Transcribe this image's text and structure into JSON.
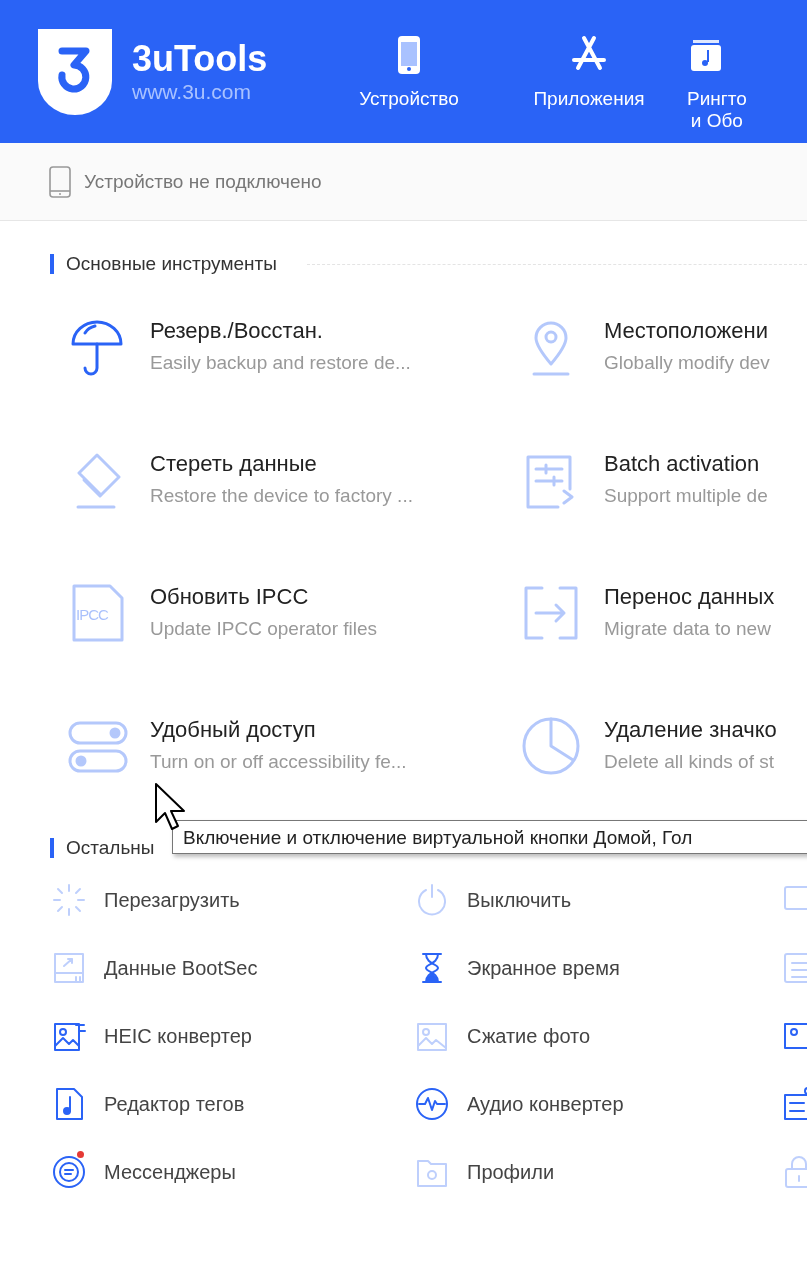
{
  "header": {
    "app_name": "3uTools",
    "site": "www.3u.com",
    "nav": [
      {
        "label": "Устройство"
      },
      {
        "label": "Приложения"
      },
      {
        "label": "Рингто",
        "label_line2": "и Обо"
      }
    ]
  },
  "device_bar": {
    "status": "Устройство не подключено"
  },
  "main_tools": {
    "title": "Основные инструменты",
    "items": [
      {
        "title": "Резерв./Восстан.",
        "description": "Easily backup and restore de...",
        "disabled": false
      },
      {
        "title": "Местоположени",
        "description": "Globally modify dev",
        "disabled": true
      },
      {
        "title": "Стереть данные",
        "description": "Restore the device to factory ...",
        "disabled": true
      },
      {
        "title": "Batch activation",
        "description": "Support multiple de",
        "disabled": true
      },
      {
        "title": "Обновить IPCC",
        "description": "Update IPCC operator files",
        "disabled": true,
        "icon_text": "IPCC"
      },
      {
        "title": "Перенос данных",
        "description": "Migrate data to new",
        "disabled": true
      },
      {
        "title": "Удобный доступ",
        "description": "Turn on or off accessibility fe...",
        "disabled": true
      },
      {
        "title": "Удаление значко",
        "description": "Delete all kinds of st",
        "disabled": true
      }
    ]
  },
  "tooltip": {
    "text": "Включение и отключение виртуальной кнопки Домой, Гол"
  },
  "other_tools": {
    "title": "Остальны",
    "items": [
      {
        "label": "Перезагрузить",
        "disabled": true,
        "new_dot": false
      },
      {
        "label": "Выключить",
        "disabled": true,
        "new_dot": false
      },
      {
        "disabled": true,
        "new_dot": false
      },
      {
        "label": "Данные BootSec",
        "disabled": true,
        "new_dot": false
      },
      {
        "label": "Экранное время",
        "disabled": false,
        "new_dot": false
      },
      {
        "disabled": true,
        "new_dot": false
      },
      {
        "label": "HEIC конвертер",
        "disabled": false,
        "new_dot": false
      },
      {
        "label": "Сжатие фото",
        "disabled": true,
        "new_dot": false
      },
      {
        "disabled": false,
        "new_dot": false
      },
      {
        "label": "Редактор тегов",
        "disabled": false,
        "new_dot": false
      },
      {
        "label": "Аудио конвертер",
        "disabled": false,
        "new_dot": false
      },
      {
        "disabled": false,
        "new_dot": false
      },
      {
        "label": "Мессенджеры",
        "disabled": false,
        "new_dot": true
      },
      {
        "label": "Профили",
        "disabled": true,
        "new_dot": false
      },
      {
        "disabled": true,
        "new_dot": false
      }
    ]
  }
}
